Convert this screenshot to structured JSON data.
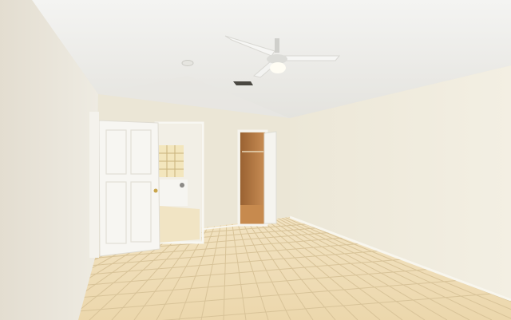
{
  "scene": {
    "subject": "empty-room-interior",
    "colors": {
      "ceiling": "#f1f0ec",
      "left_wall": "#eae7dd",
      "back_wall": "#ece8da",
      "right_wall": "#efeadb",
      "floor": "#eedcb4",
      "grout": "#d9c59a",
      "door": "#f7f6f2",
      "closet_interior": "#b97d45",
      "window_light": "#f3e6bd"
    },
    "features": [
      "ceiling-fan",
      "interior-door",
      "walk-in-closet",
      "bathroom-window",
      "tile-floor",
      "air-vent"
    ]
  }
}
